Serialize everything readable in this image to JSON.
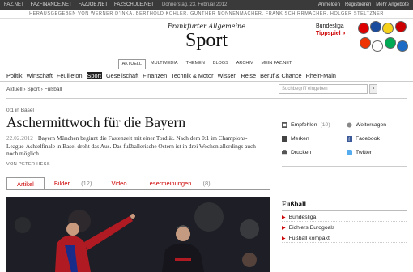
{
  "topbar": {
    "links": [
      "FAZ.NET",
      "FAZFINANCE.NET",
      "FAZJOB.NET",
      "FAZSCHULE.NET"
    ],
    "date": "Donnerstag, 23. Februar 2012",
    "login": "Anmelden",
    "register": "Registrieren",
    "more": "Mehr Angebote"
  },
  "editors": "HERAUSGEGEBEN VON WERNER D'INKA, BERTHOLD KOHLER, GÜNTHER NONNENMACHER, FRANK SCHIRRMACHER, HOLGER STELTZNER",
  "logo": {
    "faz": "Frankfurter Allgemeine",
    "section": "Sport"
  },
  "bundesliga": {
    "line1": "Bundesliga",
    "line2": "Tippspiel »"
  },
  "subnav": [
    "AKTUELL",
    "MULTIMEDIA",
    "THEMEN",
    "BLOGS",
    "ARCHIV",
    "MEIN FAZ.NET"
  ],
  "mainnav": [
    "Politik",
    "Wirtschaft",
    "Feuilleton",
    "Sport",
    "Gesellschaft",
    "Finanzen",
    "Technik & Motor",
    "Wissen",
    "Reise",
    "Beruf & Chance",
    "Rhein-Main"
  ],
  "breadcrumb": {
    "a": "Aktuell",
    "b": "Sport",
    "c": "Fußball"
  },
  "search": {
    "placeholder": "Suchbegriff eingeben"
  },
  "article": {
    "kicker": "0:1 in Basel",
    "headline": "Aschermittwoch für die Bayern",
    "date": "22.02.2012 ·",
    "teaser": " Bayern München beginnt die Fastenzeit mit einer Tordiät. Nach dem 0:1 im Champions-League-Achtelfinale in Basel droht das Aus. Das fußballerische Ostern ist in drei Wochen allerdings auch noch möglich.",
    "author": "VON PETER HESS"
  },
  "tabs": [
    {
      "label": "Artikel",
      "count": ""
    },
    {
      "label": "Bilder",
      "count": "(12)"
    },
    {
      "label": "Video",
      "count": ""
    },
    {
      "label": "Lesermeinungen",
      "count": "(8)"
    }
  ],
  "share": {
    "empfehlen": "Empfehlen",
    "empfehlen_count": "(10)",
    "weitersagen": "Weitersagen",
    "merken": "Merken",
    "facebook": "Facebook",
    "drucken": "Drucken",
    "twitter": "Twitter"
  },
  "sidebox": {
    "title": "Fußball",
    "items": [
      "Bundesliga",
      "Eichlers Eurogoals",
      "Fußball kompakt"
    ]
  },
  "colors": {
    "accent": "#cc0000",
    "dark": "#222222"
  }
}
